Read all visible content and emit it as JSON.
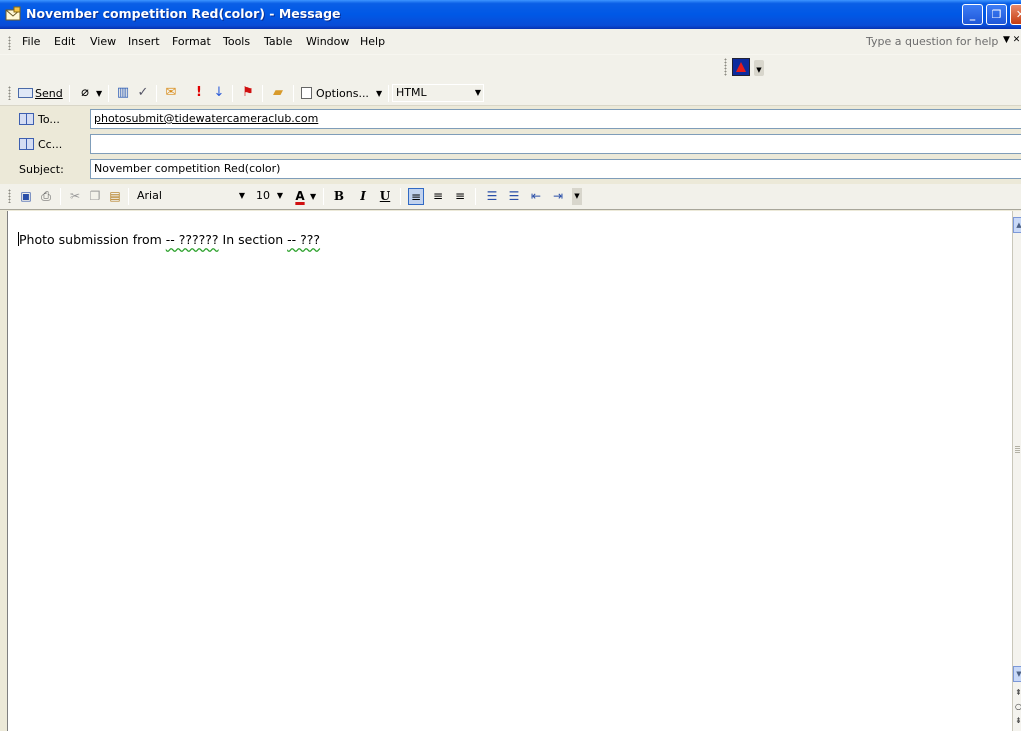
{
  "window": {
    "title": "November competition Red(color) - Message",
    "min_glyph": "_",
    "max_glyph": "❐",
    "close_glyph": "✕"
  },
  "menu": {
    "items": [
      "File",
      "Edit",
      "View",
      "Insert",
      "Format",
      "Tools",
      "Table",
      "Window",
      "Help"
    ],
    "help_placeholder": "Type a question for help"
  },
  "toolbar": {
    "send_label": "Send",
    "options_label": "Options...",
    "format_value": "HTML"
  },
  "fields": {
    "to_label": "To...",
    "to_value": "photosubmit@tidewatercameraclub.com",
    "cc_label": "Cc...",
    "cc_value": "",
    "subject_label": "Subject:",
    "subject_value": "November competition Red(color)"
  },
  "format_toolbar": {
    "font": "Arial",
    "size": "10",
    "bold": "B",
    "italic": "I",
    "underline": "U",
    "font_color_glyph": "A"
  },
  "body": {
    "text_prefix": "Photo submission from ",
    "name_placeholder": "-- ??????",
    "text_middle": " In section ",
    "section_placeholder": "-- ???"
  },
  "colors": {
    "titlebar": "#0058e6",
    "toolbar_bg": "#f2f1ea",
    "window_bg": "#ece9d8"
  }
}
